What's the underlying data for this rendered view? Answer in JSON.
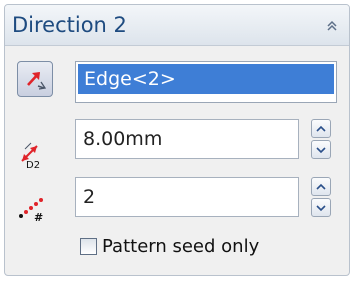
{
  "panel": {
    "title": "Direction 2",
    "collapse_icon": "double-chevron-up-icon"
  },
  "direction": {
    "reverse_icon": "reverse-direction-icon",
    "selection_value": "Edge<2>"
  },
  "spacing": {
    "icon": "spacing-d2-icon",
    "icon_label": "D2",
    "value": "8.00mm"
  },
  "instances": {
    "icon": "instances-count-icon",
    "icon_label": "#",
    "value": "2"
  },
  "pattern_seed_only": {
    "label": "Pattern seed only",
    "checked": false
  },
  "colors": {
    "title": "#1e4b80",
    "selection_highlight": "#3e7ed6",
    "icon_red": "#e0242a"
  }
}
